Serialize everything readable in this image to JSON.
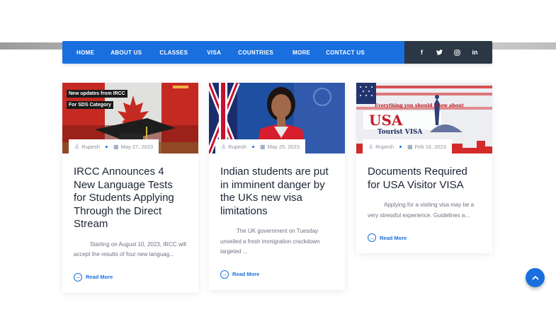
{
  "nav": {
    "items": [
      {
        "label": "HOME"
      },
      {
        "label": "ABOUT US"
      },
      {
        "label": "CLASSES"
      },
      {
        "label": "VISA"
      },
      {
        "label": "COUNTRIES"
      },
      {
        "label": "MORE"
      },
      {
        "label": "CONTACT US"
      }
    ],
    "social": [
      {
        "icon": "facebook-icon",
        "glyph": "f"
      },
      {
        "icon": "twitter-icon",
        "glyph": "𝕥"
      },
      {
        "icon": "instagram-icon",
        "glyph": "◎"
      },
      {
        "icon": "linkedin-icon",
        "glyph": "in"
      }
    ]
  },
  "posts": [
    {
      "image_captions": [
        "New updates from IRCC",
        "For SDS Category"
      ],
      "author": "Rupesh",
      "date": "May 27, 2023",
      "title": "IRCC Announces 4 New Language Tests for Students Applying Through the Direct Stream",
      "excerpt": "Starting on August 10, 2023, IRCC will accept the results of four new languag...",
      "read_more": "Read More"
    },
    {
      "author": "Rupesh",
      "date": "May 25, 2023",
      "title": "Indian students are put in imminent danger by the UKs new visa limitations",
      "excerpt": "The UK government on Tuesday unveiled a fresh immigration crackdown targeted ...",
      "read_more": "Read More"
    },
    {
      "image_captions": [
        "Everything you should know about",
        "Tourist VISA"
      ],
      "author": "Rupesh",
      "date": "Feb 16, 2023",
      "title": "Documents Required for USA Visitor VISA",
      "excerpt": "Applying for a visiting visa may be a very stressful experience. Guidelines a...",
      "read_more": "Read More"
    }
  ],
  "colors": {
    "primary": "#1a6fde",
    "social_bar": "#2b3744",
    "title": "#1b2433"
  }
}
